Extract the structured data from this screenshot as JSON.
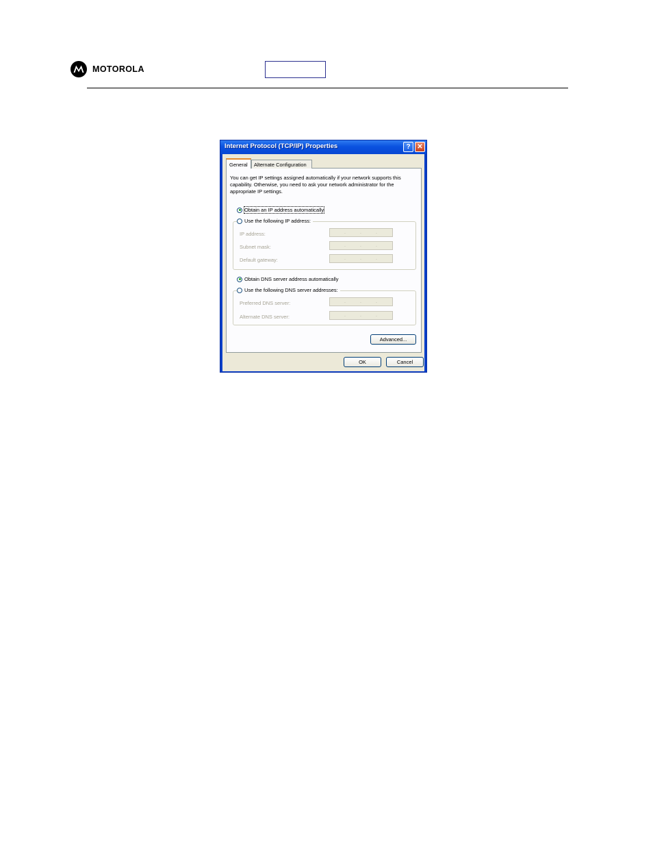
{
  "page": {
    "brand_name": "MOTOROLA"
  },
  "dialog": {
    "title": "Internet Protocol (TCP/IP) Properties",
    "help_button": "?",
    "close_button": "✕",
    "tabs": [
      {
        "label": "General",
        "selected": true
      },
      {
        "label": "Alternate Configuration",
        "selected": false
      }
    ],
    "intro_text": "You can get IP settings assigned automatically if your network supports this capability. Otherwise, you need to ask your network administrator for the appropriate IP settings.",
    "ip_section": {
      "auto_option": {
        "label": "Obtain an IP address automatically",
        "checked": true
      },
      "manual_option": {
        "label": "Use the following IP address:",
        "checked": false
      },
      "fields": [
        {
          "label": "IP address:",
          "value": ""
        },
        {
          "label": "Subnet mask:",
          "value": ""
        },
        {
          "label": "Default gateway:",
          "value": ""
        }
      ]
    },
    "dns_section": {
      "auto_option": {
        "label": "Obtain DNS server address automatically",
        "checked": true
      },
      "manual_option": {
        "label": "Use the following DNS server addresses:",
        "checked": false
      },
      "fields": [
        {
          "label": "Preferred DNS server:",
          "value": ""
        },
        {
          "label": "Alternate DNS server:",
          "value": ""
        }
      ]
    },
    "advanced_button": "Advanced...",
    "ok_button": "OK",
    "cancel_button": "Cancel"
  },
  "colors": {
    "title_bar": "#0a52e0",
    "dialog_face": "#ece9d8",
    "header_box_border": "#2b2f8f"
  }
}
